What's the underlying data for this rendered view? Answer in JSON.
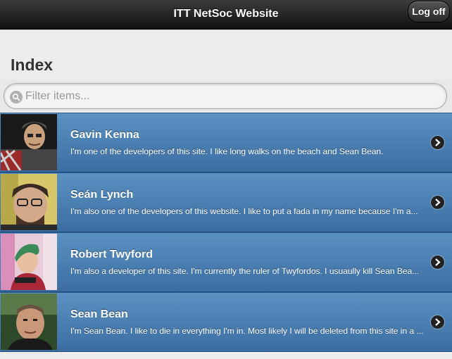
{
  "header": {
    "title": "ITT NetSoc Website",
    "logoff_label": "Log off"
  },
  "page": {
    "title": "Index"
  },
  "filter": {
    "placeholder": "Filter items...",
    "icon": "search-icon"
  },
  "members": [
    {
      "name": "Gavin Kenna",
      "description": "I'm one of the developers of this site. I like long walks on the beach and Sean Bean."
    },
    {
      "name": "Seán Lynch",
      "description": "I'm also one of the developers of this website. I like to put a fada in my name because I'm a..."
    },
    {
      "name": "Robert Twyford",
      "description": "I'm also a developer of this site. I'm currently the ruler of Twyfordos. I usuaully kill Sean Bea..."
    },
    {
      "name": "Sean Bean",
      "description": "I'm Sean Bean. I like to die in everything I'm in. Most likely I will be deleted from this site in a ..."
    }
  ],
  "colors": {
    "header_dark": "#111111",
    "list_item_top": "#5b92c2",
    "list_item_bottom": "#3b6da2",
    "background": "#e5e5e5"
  }
}
